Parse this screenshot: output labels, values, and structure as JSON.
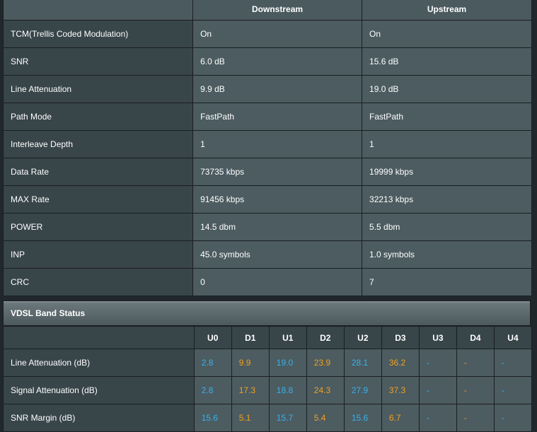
{
  "line_stats": {
    "columns": [
      "Downstream",
      "Upstream"
    ],
    "rows": [
      {
        "label": "TCM(Trellis Coded Modulation)",
        "downstream": "On",
        "upstream": "On"
      },
      {
        "label": "SNR",
        "downstream": "6.0 dB",
        "upstream": "15.6 dB"
      },
      {
        "label": "Line Attenuation",
        "downstream": "9.9 dB",
        "upstream": "19.0 dB"
      },
      {
        "label": "Path Mode",
        "downstream": "FastPath",
        "upstream": "FastPath"
      },
      {
        "label": "Interleave Depth",
        "downstream": "1",
        "upstream": "1"
      },
      {
        "label": "Data Rate",
        "downstream": "73735 kbps",
        "upstream": "19999 kbps"
      },
      {
        "label": "MAX Rate",
        "downstream": "91456 kbps",
        "upstream": "32213 kbps"
      },
      {
        "label": "POWER",
        "downstream": "14.5 dbm",
        "upstream": "5.5 dbm"
      },
      {
        "label": "INP",
        "downstream": "45.0 symbols",
        "upstream": "1.0 symbols"
      },
      {
        "label": "CRC",
        "downstream": "0",
        "upstream": "7"
      }
    ]
  },
  "band_status": {
    "title": "VDSL Band Status",
    "bands": [
      "U0",
      "D1",
      "U1",
      "D2",
      "U2",
      "D3",
      "U3",
      "D4",
      "U4"
    ],
    "rows": [
      {
        "label": "Line Attenuation (dB)",
        "values": [
          "2.8",
          "9.9",
          "19.0",
          "23.9",
          "28.1",
          "36.2",
          "-",
          "-",
          "-"
        ]
      },
      {
        "label": "Signal Attenuation (dB)",
        "values": [
          "2.8",
          "17.3",
          "18.8",
          "24.3",
          "27.9",
          "37.3",
          "-",
          "-",
          "-"
        ]
      },
      {
        "label": "SNR Margin (dB)",
        "values": [
          "15.6",
          "5.1",
          "15.7",
          "5.4",
          "15.6",
          "6.7",
          "-",
          "-",
          "-"
        ]
      }
    ]
  },
  "colors": {
    "upstream_band": "#3ab0e8",
    "downstream_band": "#f0a020",
    "background": "#21282b"
  }
}
